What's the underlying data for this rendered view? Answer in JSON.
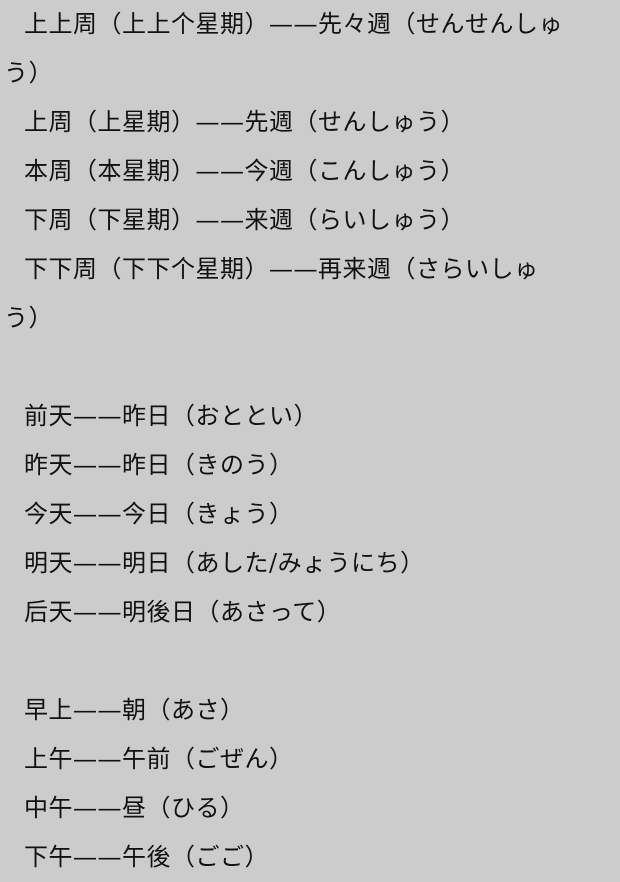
{
  "weeks": {
    "line1_a": "上上周（上上个星期）——先々週（せんせんしゅ",
    "line1_b": "う）",
    "line2": "上周（上星期）——先週（せんしゅう）",
    "line3": "本周（本星期）——今週（こんしゅう）",
    "line4": "下周（下星期）——来週（らいしゅう）",
    "line5_a": "下下周（下下个星期）——再来週（さらいしゅ",
    "line5_b": "う）"
  },
  "days": {
    "line1": "前天——昨日（おととい）",
    "line2": "昨天——昨日（きのう）",
    "line3": "今天——今日（きょう）",
    "line4": "明天——明日（あした/みょうにち）",
    "line5": "后天——明後日（あさって）"
  },
  "times": {
    "line1": "早上——朝（あさ）",
    "line2": "上午——午前（ごぜん）",
    "line3": "中午——昼（ひる）",
    "line4": "下午——午後（ごご）"
  }
}
